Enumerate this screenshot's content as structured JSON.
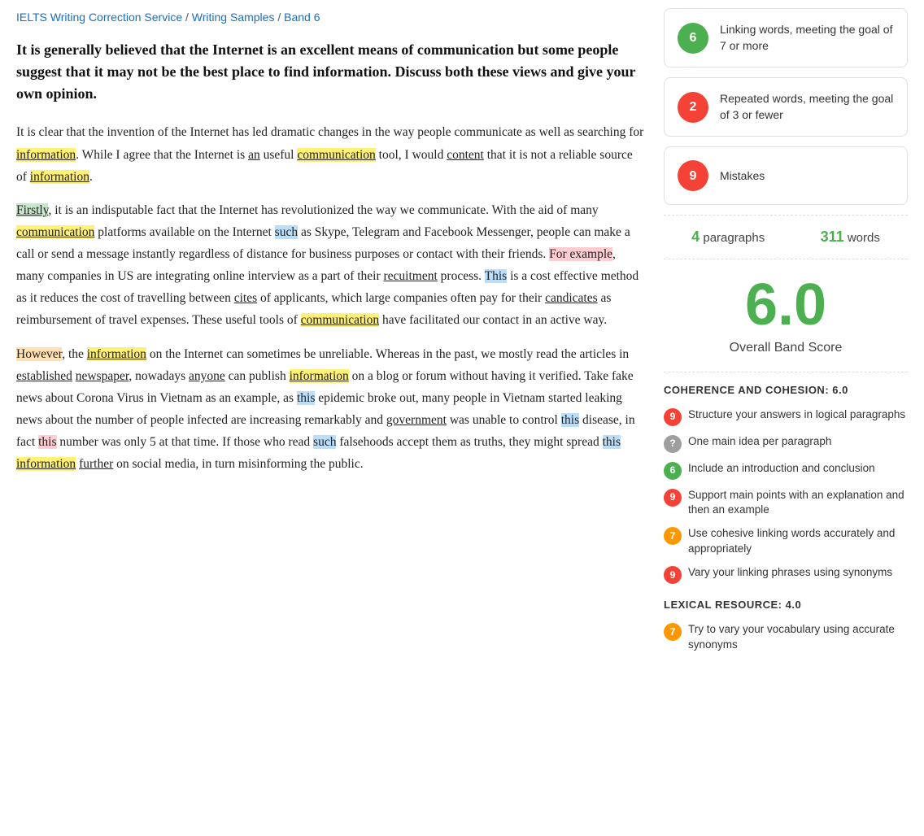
{
  "breadcrumb": {
    "items": [
      {
        "label": "IELTS Writing Correction Service",
        "href": "#"
      },
      {
        "sep": "/"
      },
      {
        "label": "Writing Samples",
        "href": "#"
      },
      {
        "sep": "/"
      },
      {
        "label": "Band 6",
        "href": "#"
      }
    ]
  },
  "essay": {
    "question": "It is generally believed that the Internet is an excellent means of communication but some people suggest that it may not be the best place to find information. Discuss both these views and give your own opinion.",
    "paragraphs": [
      {
        "id": "p1",
        "html": "It is clear that the invention of the Internet has led dramatic changes in the way people communicate as well as searching for <span class='underline highlight-yellow'>information</span>. While I agree that the Internet is <span class='underline'>an</span> useful <span class='underline highlight-yellow'>communication</span> tool, I would <span class='underline'>content</span> that it is not a reliable source of <span class='underline highlight-yellow'>information</span>."
      },
      {
        "id": "p2",
        "html": "<span class='underline highlight-green'>Firstly</span>, it is an indisputable fact that the Internet has revolutionized the way we communicate. With the aid of many <span class='underline highlight-yellow'>communication</span> platforms available on the Internet <span class='highlight-blue'>such</span> as Skype, Telegram and Facebook Messenger, people can make a call or send a message instantly regardless of distance for business purposes or contact with their friends. <span class='highlight-red'>For example</span>, many companies in US are integrating online interview as a part of their <span class='underline'>recuitment</span> process. <span class='highlight-blue'>This</span> is a cost effective method as it reduces the cost of travelling between <span class='underline'>cites</span> of applicants, which large companies often pay for their <span class='underline'>candicates</span> as reimbursement of travel expenses. These useful tools of <span class='underline highlight-yellow'>communication</span> have facilitated our contact in an active way."
      },
      {
        "id": "p3",
        "html": "<span class='highlight-orange'>However</span>, the <span class='underline highlight-yellow'>information</span> on the Internet can sometimes be unreliable. Whereas in the past, we mostly read the articles in <span class='underline'>established</span> <span class='underline'>newspaper</span>, nowadays <span class='underline'>anyone</span> can publish <span class='underline highlight-yellow'>information</span> on a blog or forum without having it verified. Take fake news about Corona Virus in Vietnam as an example, as <span class='highlight-blue'>this</span> epidemic broke out, many people in Vietnam started leaking news about the number of people infected are increasing remarkably and <span class='underline'>government</span> was unable to control <span class='highlight-blue'>this</span> disease, in fact <span class='highlight-red'>this</span> number was only 5 at that time. If those who read <span class='highlight-blue'>such</span> falsehoods accept them as truths, they might spread <span class='highlight-blue'>this</span> <span class='underline highlight-yellow'>information</span> <span class='underline'>further</span> on social media, in turn misinforming the public."
      }
    ]
  },
  "sidebar": {
    "score_cards": [
      {
        "badge": "6",
        "badge_class": "badge-green",
        "text": "Linking words, meeting the goal of 7 or more"
      },
      {
        "badge": "2",
        "badge_class": "badge-red",
        "text": "Repeated words, meeting the goal of 3 or fewer"
      },
      {
        "badge": "9",
        "badge_class": "badge-red",
        "text": "Mistakes"
      }
    ],
    "stats": {
      "paragraphs_count": "4",
      "paragraphs_label": "paragraphs",
      "words_count": "311",
      "words_label": "words"
    },
    "overall": {
      "score": "6.0",
      "label": "Overall Band Score"
    },
    "coherence_section": {
      "header": "COHERENCE AND COHESION: 6.0",
      "items": [
        {
          "badge": "9",
          "badge_class": "fb-red",
          "text": "Structure your answers in logical paragraphs"
        },
        {
          "badge": "?",
          "badge_class": "fb-gray",
          "text": "One main idea per paragraph"
        },
        {
          "badge": "6",
          "badge_class": "fb-green",
          "text": "Include an introduction and conclusion"
        },
        {
          "badge": "9",
          "badge_class": "fb-red",
          "text": "Support main points with an explanation and then an example"
        },
        {
          "badge": "7",
          "badge_class": "fb-yellow",
          "text": "Use cohesive linking words accurately and appropriately"
        },
        {
          "badge": "9",
          "badge_class": "fb-red",
          "text": "Vary your linking phrases using synonyms"
        }
      ]
    },
    "lexical_section": {
      "header": "LEXICAL RESOURCE: 4.0",
      "items": [
        {
          "badge": "7",
          "badge_class": "fb-yellow",
          "text": "Try to vary your vocabulary using accurate synonyms"
        }
      ]
    }
  }
}
